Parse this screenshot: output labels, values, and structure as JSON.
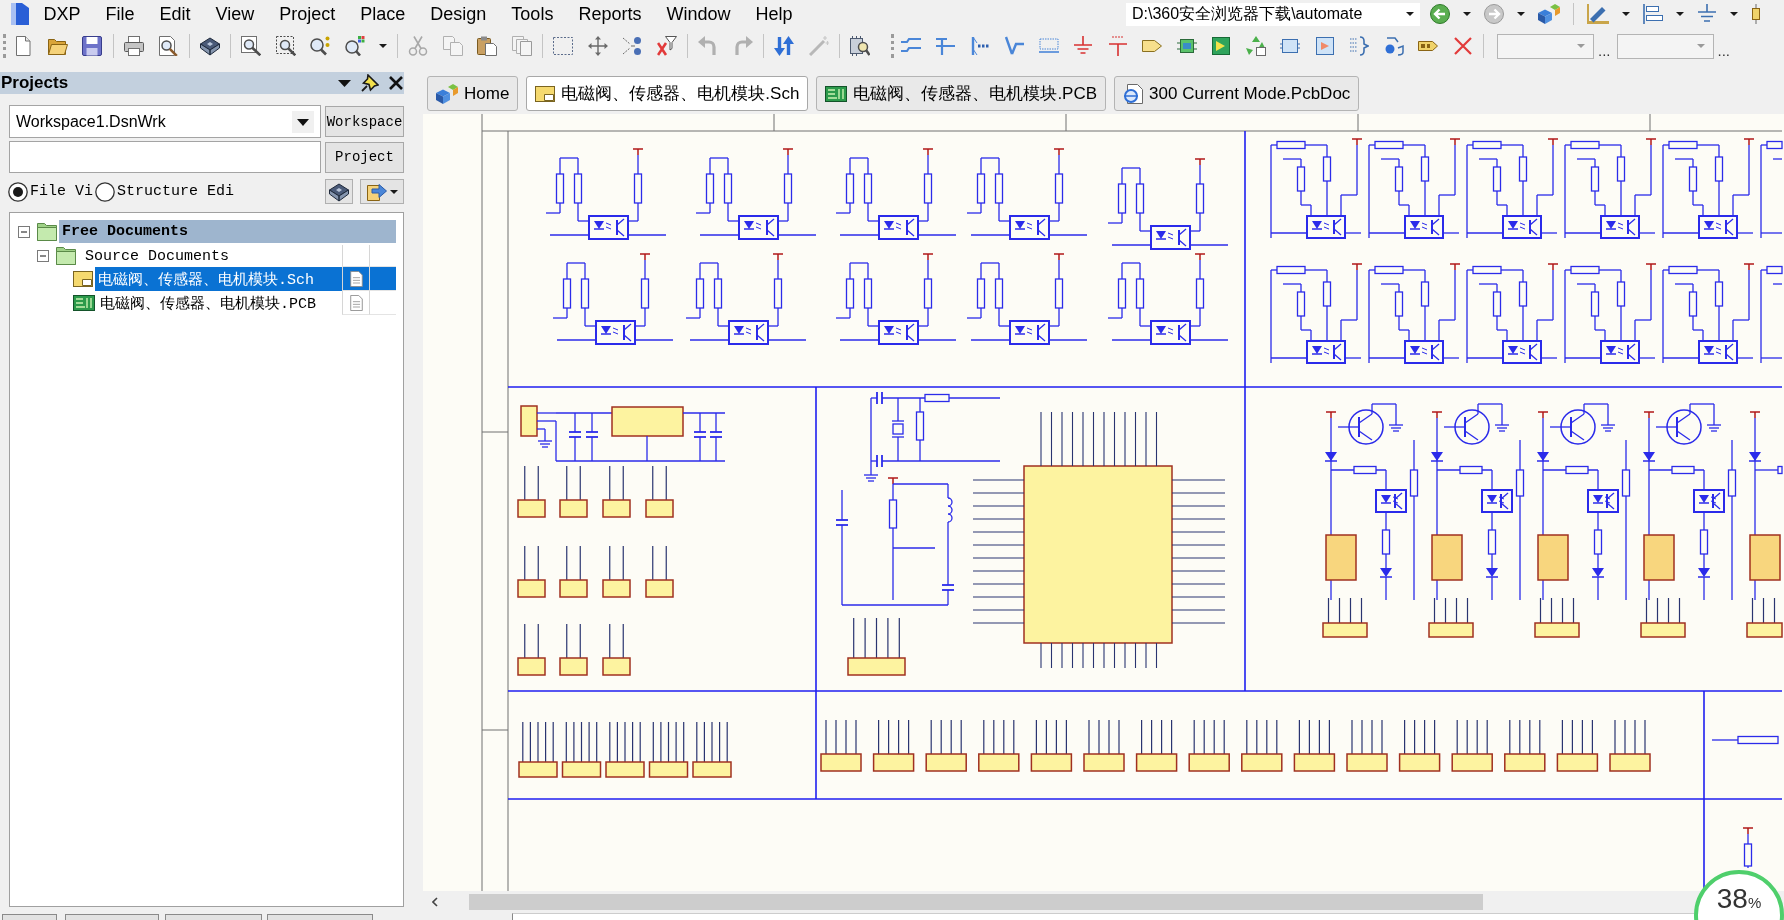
{
  "menu_bar": {
    "items": [
      "DXP",
      "File",
      "Edit",
      "View",
      "Project",
      "Place",
      "Design",
      "Tools",
      "Reports",
      "Window",
      "Help"
    ],
    "path_field": {
      "value": "D:\\360安全浏览器下载\\automate"
    }
  },
  "toolbar": {
    "more_buttons": [
      "...",
      "..."
    ]
  },
  "projects_panel": {
    "title": "Projects",
    "workspace_field": {
      "value": "Workspace1.DsnWrk"
    },
    "workspace_button": "Workspace",
    "project_button": "Project",
    "view_options": [
      {
        "label": "File Vi",
        "selected": true
      },
      {
        "label": "Structure Edi",
        "selected": false
      }
    ],
    "tree": [
      {
        "label": "Free Documents",
        "kind": "group",
        "expanded": true,
        "selected": false,
        "children": [
          {
            "label": "Source Documents",
            "kind": "folder",
            "expanded": true,
            "selected": false,
            "children": [
              {
                "label": "电磁阀、传感器、电机模块.Sch",
                "kind": "schematic",
                "selected": true
              },
              {
                "label": "电磁阀、传感器、电机模块.PCB",
                "kind": "pcb",
                "selected": false
              }
            ]
          }
        ]
      }
    ]
  },
  "document_tabs": [
    {
      "label": "Home",
      "kind": "home",
      "selected": false
    },
    {
      "label": "电磁阀、传感器、电机模块.Sch",
      "kind": "schematic",
      "selected": true
    },
    {
      "label": "电磁阀、传感器、电机模块.PCB",
      "kind": "pcb",
      "selected": false
    },
    {
      "label": "300 Current Mode.PcbDoc",
      "kind": "pcbdoc",
      "selected": false
    }
  ],
  "progress_badge": {
    "value": "38",
    "unit": "%"
  }
}
